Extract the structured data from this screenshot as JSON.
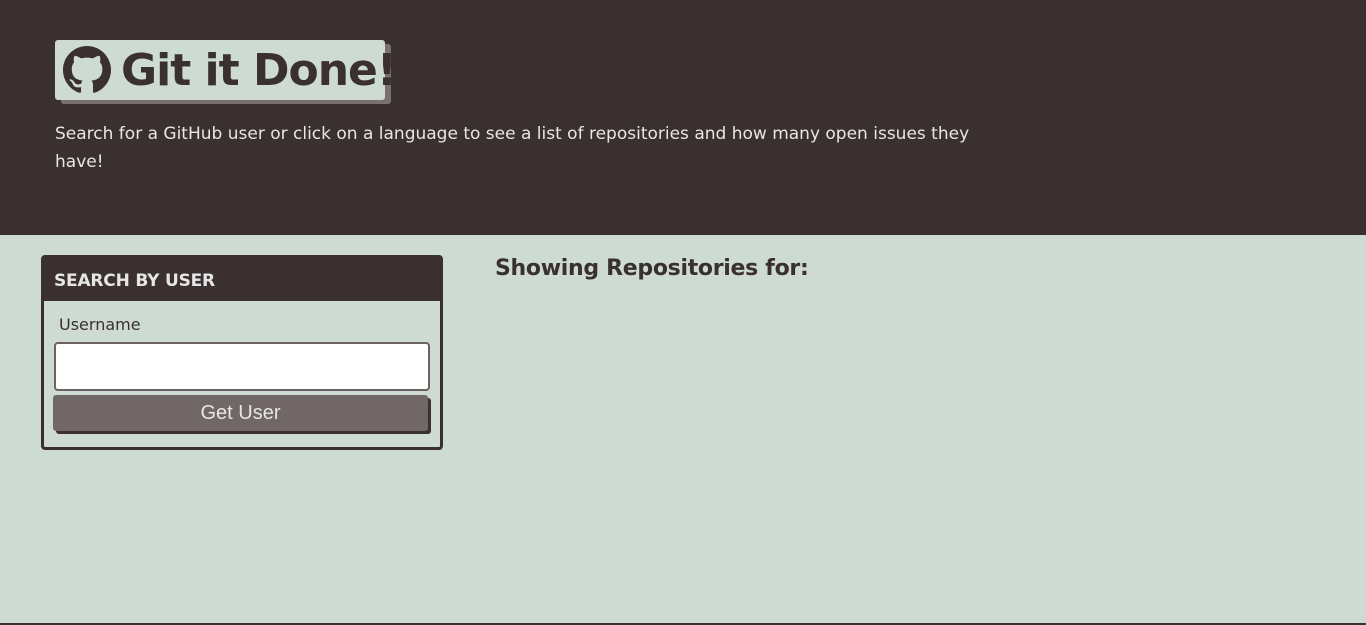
{
  "header": {
    "title": "Git it Done!",
    "subtitle": "Search for a GitHub user or click on a language to see a list of repositories and how many open issues they have!",
    "logo_icon": "github-icon"
  },
  "search_panel": {
    "heading": "SEARCH BY USER",
    "username_label": "Username",
    "username_value": "",
    "submit_label": "Get User"
  },
  "repos": {
    "heading": "Showing Repositories for:",
    "search_term": ""
  },
  "colors": {
    "dark": "#3a3030",
    "light": "#cddbd2",
    "button": "#706766",
    "text_light": "#e6e6e6"
  }
}
